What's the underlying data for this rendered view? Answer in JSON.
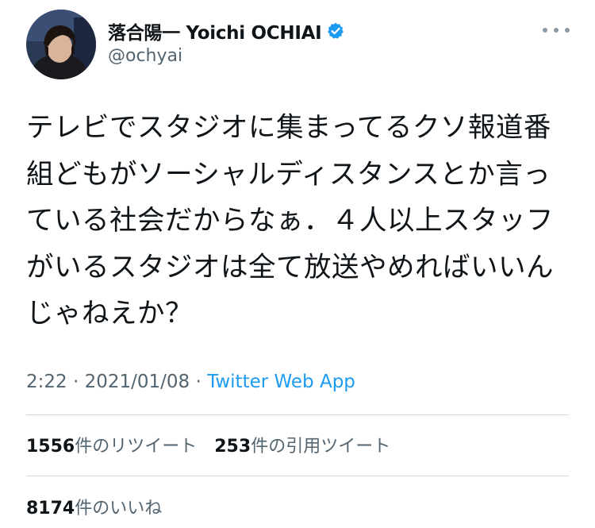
{
  "author": {
    "display_name": "落合陽一 Yoichi OCHIAI",
    "handle": "@ochyai",
    "verified_icon": "verified-badge-icon",
    "avatar_icon": "profile-photo"
  },
  "tweet": {
    "text": "テレビでスタジオに集まってるクソ報道番組どもがソーシャルディスタンスとか言っている社会だからなぁ．４人以上スタッフがいるスタジオは全て放送やめればいいんじゃねえか？",
    "time": "2:22",
    "separator": "·",
    "date": "2021/01/08",
    "app": "Twitter Web App"
  },
  "stats": {
    "retweets_count": "1556",
    "retweets_label": "件のリツイート",
    "quotes_count": "253",
    "quotes_label": "件の引用ツイート",
    "likes_count": "8174",
    "likes_label": "件のいいね"
  },
  "colors": {
    "link": "#1d9bf0",
    "secondary_text": "#536471",
    "primary_text": "#0f1419",
    "divider": "#cfd9de"
  }
}
